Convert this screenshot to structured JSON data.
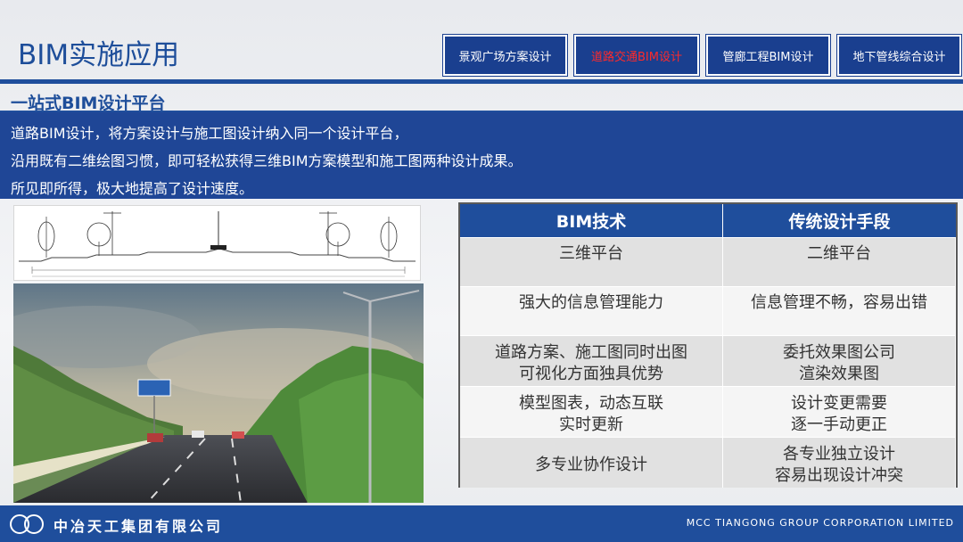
{
  "header": {
    "title": "BIM实施应用",
    "tabs": [
      {
        "label": "景观广场方案设计",
        "active": false
      },
      {
        "label": "道路交通BIM设计",
        "active": true
      },
      {
        "label": "管廊工程BIM设计",
        "active": false
      },
      {
        "label": "地下管线综合设计",
        "active": false
      }
    ]
  },
  "section": {
    "title": "一站式BIM设计平台",
    "lines": [
      "道路BIM设计，将方案设计与施工图设计纳入同一个设计平台，",
      "沿用既有二维绘图习惯，即可轻松获得三维BIM方案模型和施工图两种设计成果。",
      "所见即所得，极大地提高了设计速度。"
    ]
  },
  "table": {
    "headers": [
      "BIM技术",
      "传统设计手段"
    ],
    "rows": [
      {
        "bim": [
          "三维平台"
        ],
        "trad": [
          "二维平台"
        ]
      },
      {
        "bim": [
          "强大的信息管理能力"
        ],
        "trad": [
          "信息管理不畅，容易出错"
        ]
      },
      {
        "bim": [
          "道路方案、施工图同时出图",
          "可视化方面独具优势"
        ],
        "trad": [
          "委托效果图公司",
          "渲染效果图"
        ]
      },
      {
        "bim": [
          "模型图表，动态互联",
          "实时更新"
        ],
        "trad": [
          "设计变更需要",
          "逐一手动更正"
        ]
      },
      {
        "bim": [
          "多专业协作设计"
        ],
        "trad": [
          "各专业独立设计",
          "容易出现设计冲突"
        ]
      }
    ]
  },
  "footer": {
    "company_cn": "中冶天工集团有限公司",
    "company_en": "MCC TIANGONG GROUP CORPORATION LIMITED"
  },
  "colors": {
    "primary_blue": "#1f4e9c",
    "active_tab_text": "#ff2a2a"
  }
}
